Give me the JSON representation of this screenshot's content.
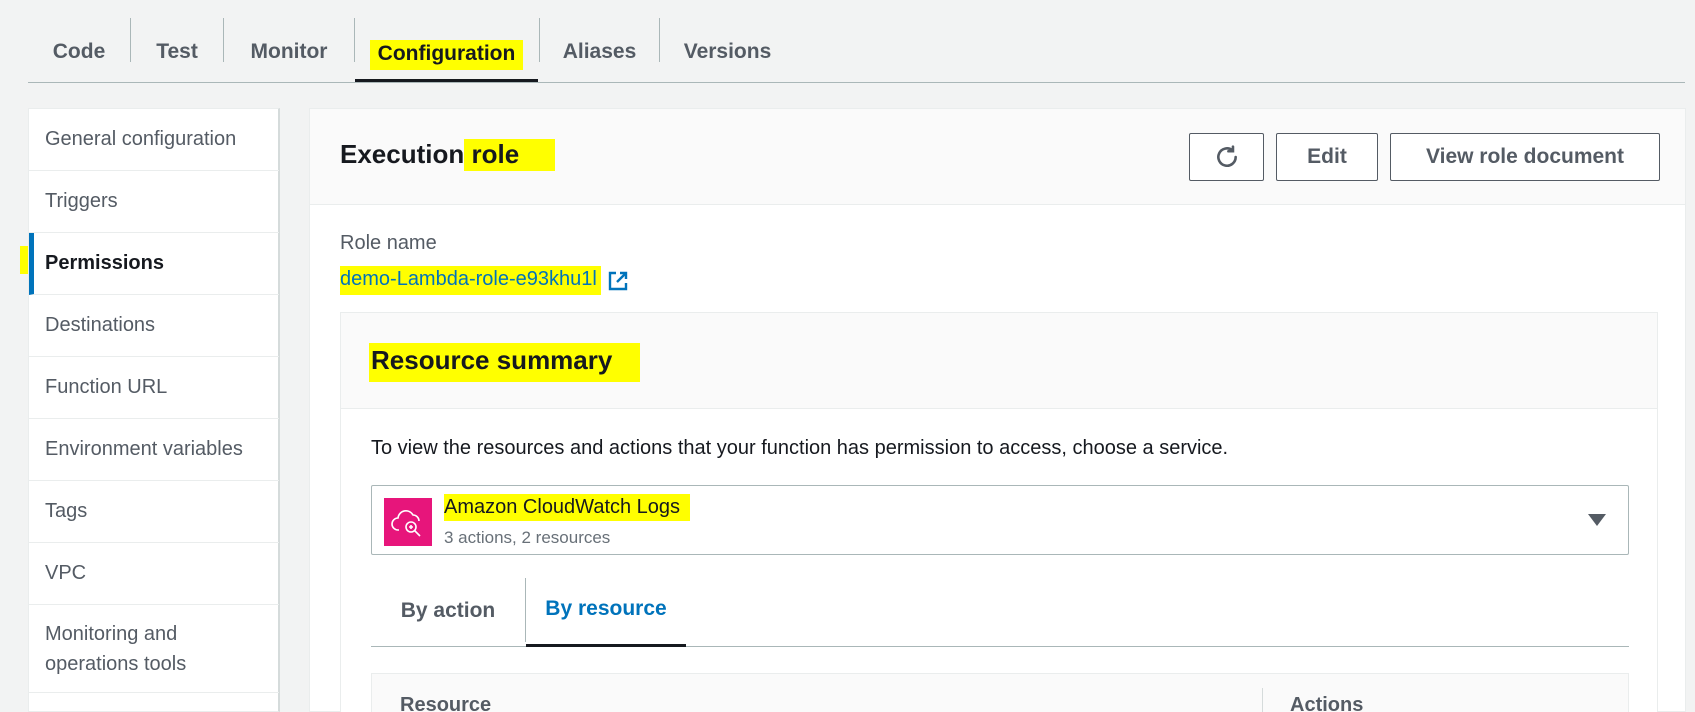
{
  "top_tabs": {
    "code": "Code",
    "test": "Test",
    "monitor": "Monitor",
    "configuration": "Configuration",
    "aliases": "Aliases",
    "versions": "Versions"
  },
  "side_nav": {
    "general_configuration": "General configuration",
    "triggers": "Triggers",
    "permissions": "Permissions",
    "destinations": "Destinations",
    "function_url": "Function URL",
    "environment_variables": "Environment variables",
    "tags": "Tags",
    "vpc": "VPC",
    "monitoring_line1": "Monitoring and",
    "monitoring_line2": "operations tools"
  },
  "execution_role": {
    "title_part1": "Execution",
    "title_part2": " role",
    "edit_label": "Edit",
    "view_label": "View role document",
    "refresh_icon": "refresh-icon",
    "role_name_label": "Role name",
    "role_name": "demo-Lambda-role-e93khu1l",
    "external_icon": "external-link-icon"
  },
  "resource_summary": {
    "title": "Resource summary",
    "description": "To view the resources and actions that your function has permission to access, choose a service.",
    "service_name": "Amazon CloudWatch Logs",
    "service_summary": "3 actions, 2 resources",
    "tab_by_action": "By action",
    "tab_by_resource": "By resource",
    "col_resource": "Resource",
    "col_actions": "Actions"
  },
  "colors": {
    "highlight": "#ffff00",
    "accent_blue": "#0073bb",
    "cloudwatch_pink": "#e7157b"
  }
}
